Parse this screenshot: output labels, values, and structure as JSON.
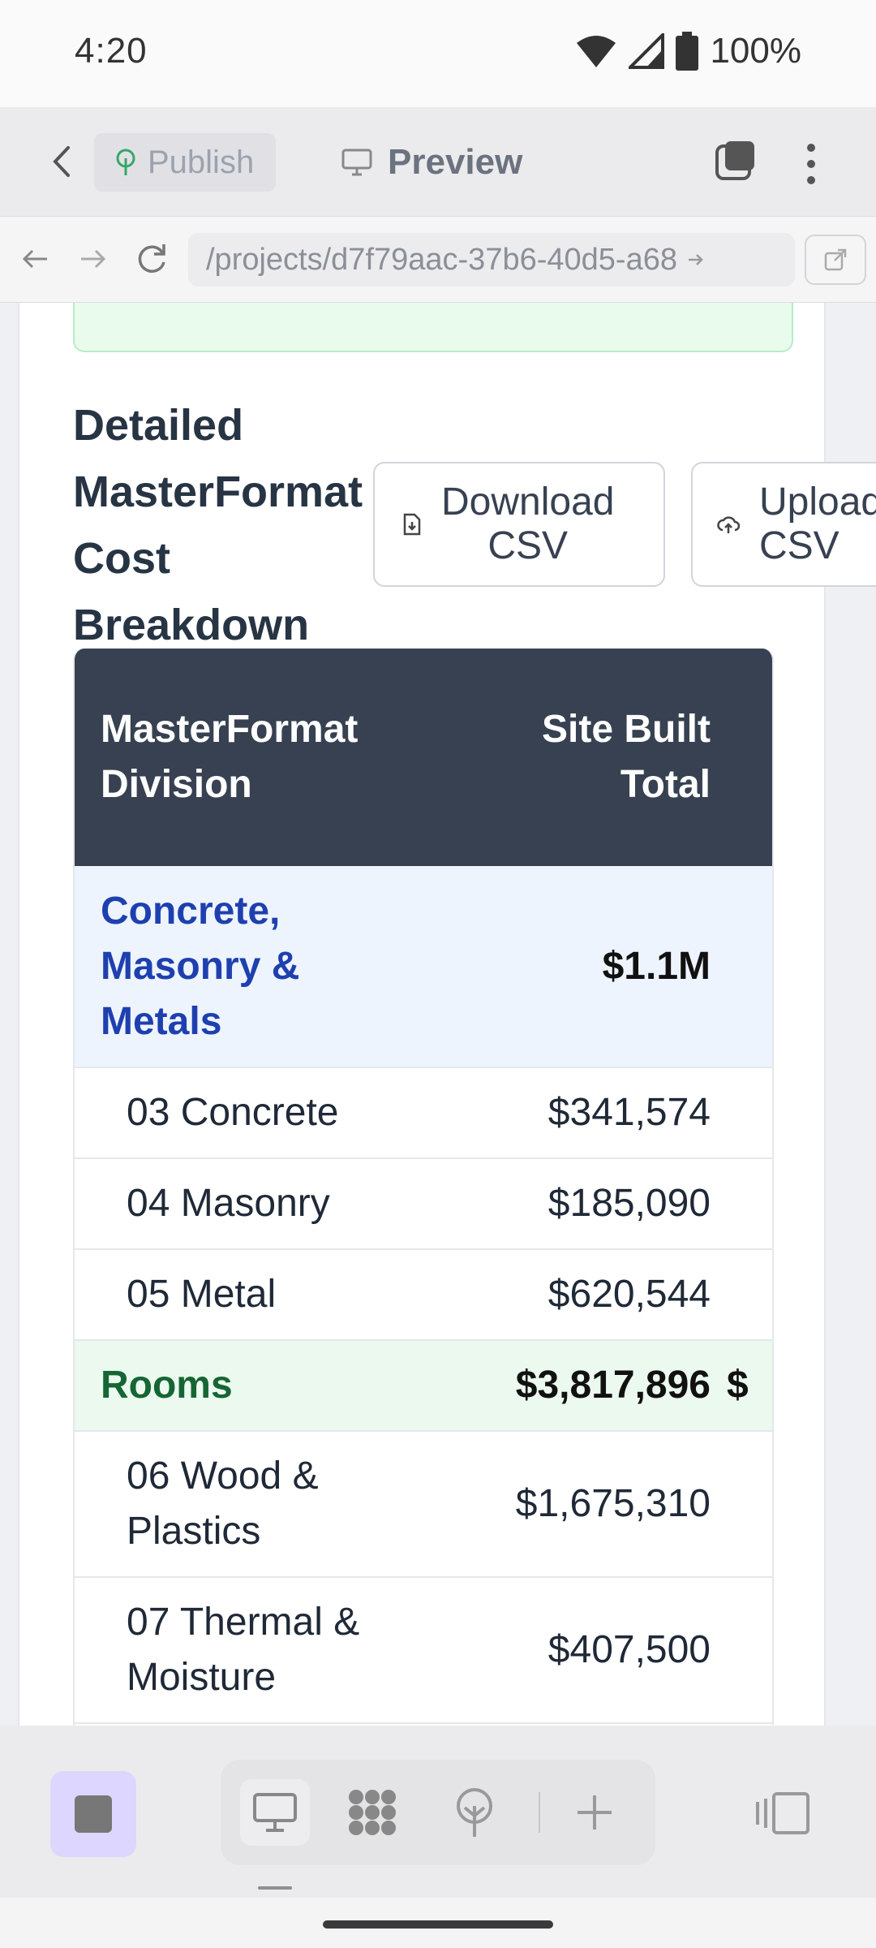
{
  "status_bar": {
    "time": "4:20",
    "battery": "100%"
  },
  "toolbar": {
    "publish_label": "Publish",
    "preview_label": "Preview"
  },
  "url_bar": {
    "url": "/projects/d7f79aac-37b6-40d5-a68"
  },
  "section": {
    "title_lines": [
      "Detailed",
      "MasterFormat",
      "Cost",
      "Breakdown"
    ],
    "download_line1": "Download",
    "download_line2": "CSV",
    "upload_line1": "Upload",
    "upload_line2": "CSV"
  },
  "table": {
    "header_col1_line1": "MasterFormat",
    "header_col1_line2": "Division",
    "header_col2_line1": "Site Built",
    "header_col2_line2": "Total",
    "groups": [
      {
        "name_lines": [
          "Concrete,",
          "Masonry &",
          "Metals"
        ],
        "total": "$1.1M",
        "items": [
          {
            "name": "03 Concrete",
            "total": "$341,574"
          },
          {
            "name": "04 Masonry",
            "total": "$185,090"
          },
          {
            "name": "05 Metal",
            "total": "$620,544"
          }
        ]
      },
      {
        "name": "Rooms",
        "total": "$3,817,896",
        "extra": "$",
        "items": [
          {
            "name_line1": "06 Wood &",
            "name_line2": "Plastics",
            "total": "$1,675,310"
          },
          {
            "name_line1": "07 Thermal &",
            "name_line2": "Moisture",
            "total": "$407,500"
          }
        ]
      }
    ]
  },
  "colors": {
    "header_bg": "#374151",
    "group_blue_bg": "#eef4fe",
    "group_blue_text": "#1e40af",
    "group_green_bg": "#ebf9ee",
    "group_green_text": "#166534",
    "active_tool_bg": "#ddd6fe"
  }
}
